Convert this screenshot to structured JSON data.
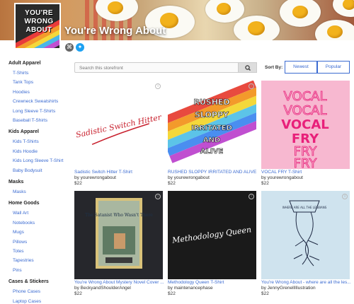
{
  "shop": {
    "title": "You're Wrong About",
    "avatar_lines": [
      "YOU'RE",
      "WRONG",
      "ABOUT"
    ]
  },
  "social": [
    {
      "name": "link-icon",
      "glyph": "⌘",
      "color": "#666"
    },
    {
      "name": "twitter-icon",
      "glyph": "✦",
      "color": "#1da1f2"
    }
  ],
  "sidebar": [
    {
      "label": "Adult Apparel",
      "items": [
        "T-Shirts",
        "Tank Tops",
        "Hoodies",
        "Crewneck Sweatshirts",
        "Long Sleeve T-Shirts",
        "Baseball T-Shirts"
      ]
    },
    {
      "label": "Kids Apparel",
      "items": [
        "Kids T-Shirts",
        "Kids Hoodie",
        "Kids Long Sleeve T-Shirt",
        "Baby Bodysuit"
      ]
    },
    {
      "label": "Masks",
      "items": [
        "Masks"
      ]
    },
    {
      "label": "Home Goods",
      "items": [
        "Wall Art",
        "Notebooks",
        "Mugs",
        "Pillows",
        "Totes",
        "Tapestries",
        "Pins"
      ]
    },
    {
      "label": "Cases & Stickers",
      "items": [
        "Phone Cases",
        "Laptop Cases"
      ]
    }
  ],
  "search": {
    "placeholder": "Search this storefront"
  },
  "sort": {
    "label": "Sort By:",
    "options": [
      "Newest",
      "Popular"
    ]
  },
  "products": [
    {
      "title": "Sadistic Switch Hitter T-Shirt",
      "artist": "by yourewrongabout",
      "price": "$22",
      "art_text": "Sadistic Switch Hitter",
      "bg": "#ffffff"
    },
    {
      "title": "RUSHED SLOPPY IRRITATED AND ALIVE T-...",
      "artist": "by yourewrongabout",
      "price": "$22",
      "art_text": "RUSHED SLOPPY IRRITATED AND ALIVE",
      "bg": "#ffffff"
    },
    {
      "title": "VOCAL FRY T-Shirt",
      "artist": "by yourewrongabout",
      "price": "$22",
      "art_lines": [
        "VOCAL",
        "VOCAL",
        "VOCAL",
        "FRY",
        "FRY",
        "FRY"
      ],
      "bg": "#f7b8d0"
    },
    {
      "title": "You're Wrong About Mystery Novel Cover ...",
      "artist": "by BeckyandShoulderAngel",
      "price": "$22",
      "art_text": "The Satanist Who Wasn't There",
      "bg": "#26272c"
    },
    {
      "title": "Methodology Queen T-Shirt",
      "artist": "by maintenancephase",
      "price": "$22",
      "art_text": "Methodology Queen",
      "bg": "#1a1a1a"
    },
    {
      "title": "You're Wrong About - where are all the les...",
      "artist": "by JennyGrenellIllustration",
      "price": "$22",
      "art_text": "WHERE ARE ALL THE LESBIANS",
      "bg": "#cfe3ee"
    }
  ]
}
